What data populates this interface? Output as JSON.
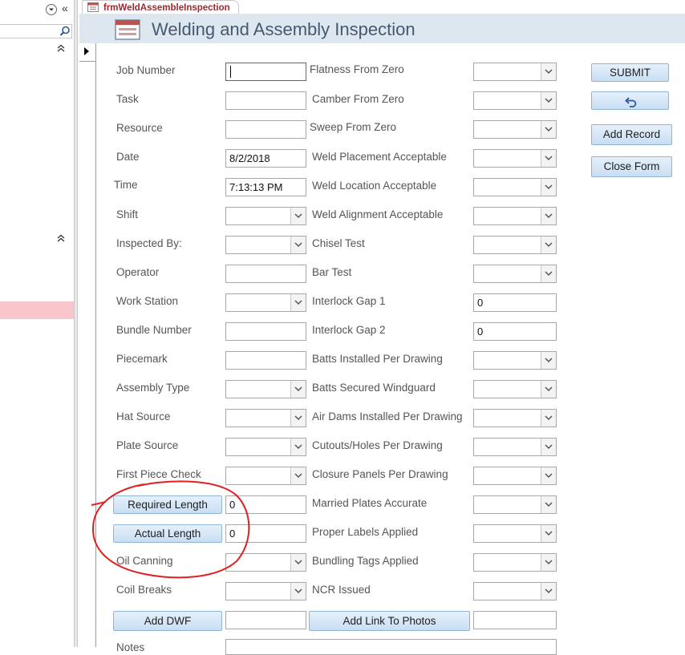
{
  "tab": {
    "label": "frmWeldAssembleInspection"
  },
  "header": {
    "title": "Welding and Assembly Inspection"
  },
  "left_fields": [
    {
      "label": "Job Number",
      "type": "text",
      "value": ""
    },
    {
      "label": "Task",
      "type": "text",
      "value": ""
    },
    {
      "label": "Resource",
      "type": "text",
      "value": ""
    },
    {
      "label": "Date",
      "type": "text",
      "value": "8/2/2018"
    },
    {
      "label": "Time",
      "type": "text",
      "value": "7:13:13 PM"
    },
    {
      "label": "Shift",
      "type": "combo",
      "value": ""
    },
    {
      "label": "Inspected By:",
      "type": "combo",
      "value": ""
    },
    {
      "label": "Operator",
      "type": "text",
      "value": ""
    },
    {
      "label": "Work Station",
      "type": "combo",
      "value": ""
    },
    {
      "label": "Bundle Number",
      "type": "text",
      "value": ""
    },
    {
      "label": "Piecemark",
      "type": "text",
      "value": ""
    },
    {
      "label": "Assembly Type",
      "type": "combo",
      "value": ""
    },
    {
      "label": "Hat Source",
      "type": "combo",
      "value": ""
    },
    {
      "label": "Plate Source",
      "type": "combo",
      "value": ""
    },
    {
      "label": "First Piece Check",
      "type": "combo",
      "value": ""
    },
    {
      "label": "Required Length",
      "type": "button-text",
      "value": "0"
    },
    {
      "label": "Actual Length",
      "type": "button-text",
      "value": "0"
    },
    {
      "label": "Oil Canning",
      "type": "combo",
      "value": ""
    },
    {
      "label": "Coil Breaks",
      "type": "combo",
      "value": ""
    }
  ],
  "right_fields": [
    {
      "label": "Flatness From Zero",
      "type": "combo",
      "value": ""
    },
    {
      "label": "Camber From Zero",
      "type": "combo",
      "value": ""
    },
    {
      "label": "Sweep From Zero",
      "type": "combo",
      "value": ""
    },
    {
      "label": "Weld Placement Acceptable",
      "type": "combo",
      "value": ""
    },
    {
      "label": "Weld Location Acceptable",
      "type": "combo",
      "value": ""
    },
    {
      "label": "Weld Alignment Acceptable",
      "type": "combo",
      "value": ""
    },
    {
      "label": "Chisel Test",
      "type": "combo",
      "value": ""
    },
    {
      "label": "Bar Test",
      "type": "combo",
      "value": ""
    },
    {
      "label": "Interlock Gap 1",
      "type": "text",
      "value": "0"
    },
    {
      "label": "Interlock Gap 2",
      "type": "text",
      "value": "0"
    },
    {
      "label": "Batts Installed Per Drawing",
      "type": "combo",
      "value": ""
    },
    {
      "label": "Batts Secured Windguard",
      "type": "combo",
      "value": ""
    },
    {
      "label": "Air Dams Installed Per Drawing",
      "type": "combo",
      "value": ""
    },
    {
      "label": "Cutouts/Holes Per Drawing",
      "type": "combo",
      "value": ""
    },
    {
      "label": "Closure Panels Per Drawing",
      "type": "combo",
      "value": ""
    },
    {
      "label": "Married Plates Accurate",
      "type": "combo",
      "value": ""
    },
    {
      "label": "Proper Labels Applied",
      "type": "combo",
      "value": ""
    },
    {
      "label": "Bundling Tags Applied",
      "type": "combo",
      "value": ""
    },
    {
      "label": "NCR Issued",
      "type": "combo",
      "value": ""
    }
  ],
  "buttons": {
    "submit": "SUBMIT",
    "undo_icon": "undo-arrow-icon",
    "add_record": "Add Record",
    "close_form": "Close Form",
    "add_dwf": "Add DWF",
    "add_link_photos": "Add Link To Photos"
  },
  "bottom": {
    "dwf_value": "",
    "photos_value": "",
    "notes_label": "Notes"
  },
  "colors": {
    "header_bg": "#dee6ef",
    "title": "#455a6f",
    "tab_text": "#a4262c",
    "nav_highlight": "#f8c6cb",
    "annotation": "#e02020"
  }
}
